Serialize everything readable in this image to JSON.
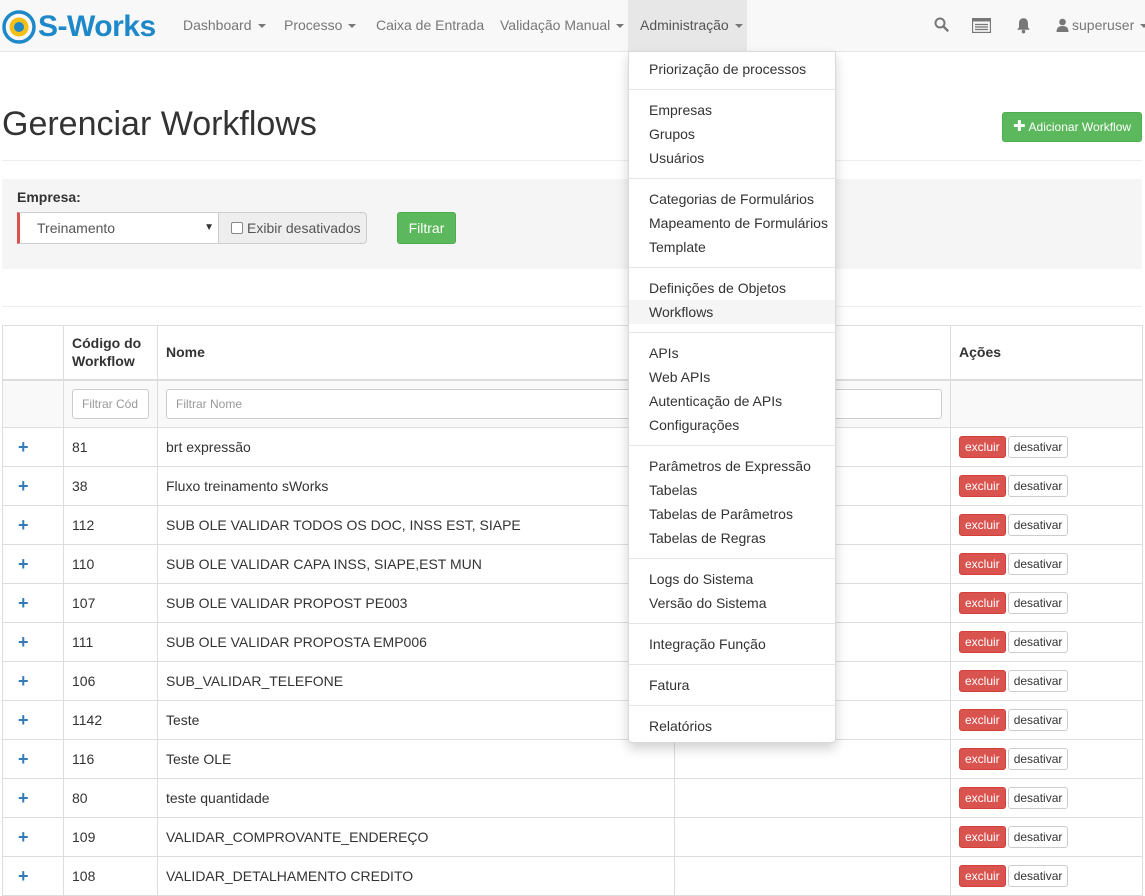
{
  "brand": {
    "name": "S-Works"
  },
  "nav": {
    "items": [
      {
        "label": "Dashboard",
        "dropdown": true
      },
      {
        "label": "Processo",
        "dropdown": true
      },
      {
        "label": "Caixa de Entrada",
        "dropdown": false
      },
      {
        "label": "Validação Manual",
        "dropdown": true
      },
      {
        "label": "Administração",
        "dropdown": true,
        "active": true
      }
    ],
    "icons": [
      "search-icon",
      "inbox-icon",
      "bell-icon"
    ],
    "user": "superuser"
  },
  "page": {
    "title": "Gerenciar Workflows",
    "add_button": "Adicionar Workflow"
  },
  "filter": {
    "empresa_label": "Empresa:",
    "empresa_value": "Treinamento",
    "show_disabled_label": "Exibir desativados",
    "filter_button": "Filtrar"
  },
  "table": {
    "headers": {
      "codigo": "Código do Workflow",
      "nome": "Nome",
      "acoes": "Ações"
    },
    "filters": {
      "codigo_placeholder": "Filtrar Cód",
      "nome_placeholder": "Filtrar Nome"
    },
    "action_delete": "excluir",
    "action_deactivate": "desativar",
    "rows": [
      {
        "codigo": "81",
        "nome": "brt expressão"
      },
      {
        "codigo": "38",
        "nome": "Fluxo treinamento sWorks"
      },
      {
        "codigo": "112",
        "nome": "SUB OLE VALIDAR TODOS OS DOC, INSS EST, SIAPE"
      },
      {
        "codigo": "110",
        "nome": "SUB OLE VALIDAR CAPA INSS, SIAPE,EST MUN"
      },
      {
        "codigo": "107",
        "nome": "SUB OLE VALIDAR PROPOST PE003"
      },
      {
        "codigo": "111",
        "nome": "SUB OLE VALIDAR PROPOSTA EMP006"
      },
      {
        "codigo": "106",
        "nome": "SUB_VALIDAR_TELEFONE"
      },
      {
        "codigo": "1142",
        "nome": "Teste"
      },
      {
        "codigo": "116",
        "nome": "Teste OLE"
      },
      {
        "codigo": "80",
        "nome": "teste quantidade"
      },
      {
        "codigo": "109",
        "nome": "VALIDAR_COMPROVANTE_ENDEREÇO"
      },
      {
        "codigo": "108",
        "nome": "VALIDAR_DETALHAMENTO CREDITO"
      }
    ]
  },
  "admin_menu": {
    "groups": [
      [
        "Priorização de processos"
      ],
      [
        "Empresas",
        "Grupos",
        "Usuários"
      ],
      [
        "Categorias de Formulários",
        "Mapeamento de Formulários",
        "Template"
      ],
      [
        "Definições de Objetos",
        "Workflows"
      ],
      [
        "APIs",
        "Web APIs",
        "Autenticação de APIs",
        "Configurações"
      ],
      [
        "Parâmetros de Expressão",
        "Tabelas",
        "Tabelas de Parâmetros",
        "Tabelas de Regras"
      ],
      [
        "Logs do Sistema",
        "Versão do Sistema"
      ],
      [
        "Integração Função"
      ],
      [
        "Fatura"
      ],
      [
        "Relatórios"
      ]
    ],
    "highlighted": "Workflows"
  },
  "colors": {
    "brand": "#1e88c8",
    "success": "#5cb85c",
    "danger": "#d9534f",
    "link": "#337ab7"
  }
}
